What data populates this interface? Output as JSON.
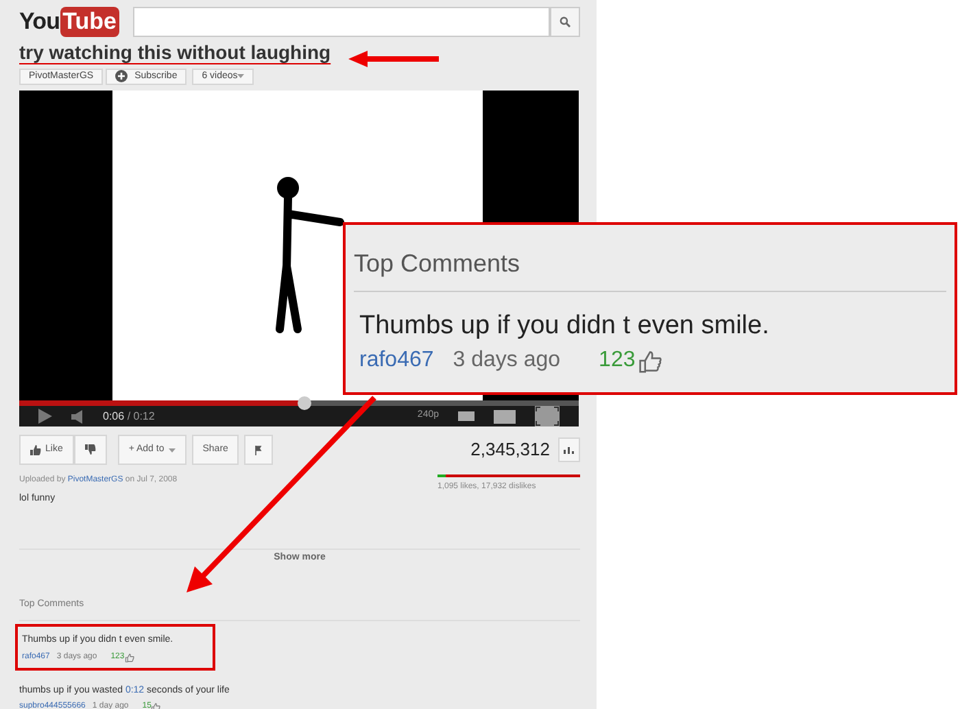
{
  "header": {
    "logo_left": "You",
    "logo_right": "Tube"
  },
  "video_title": "try watching this without laughing",
  "channel_bar": {
    "channel": "PivotMasterGS",
    "subscribe": "Subscribe",
    "videos": "6 videos"
  },
  "player": {
    "time_current": "0:06",
    "time_total": "/ 0:12",
    "quality": "240p",
    "level": 0.51
  },
  "actions": [
    {
      "kind": "like",
      "label": "Like"
    },
    {
      "kind": "dislike"
    },
    {
      "kind": "add",
      "label": "+ Add to"
    },
    {
      "kind": "share",
      "label": "Share"
    },
    {
      "kind": "flag"
    }
  ],
  "view_count": "2,345,312",
  "ratings": {
    "level": 0.06,
    "text": "1,095 likes, 17,932 dislikes"
  },
  "upload": {
    "prefix": "Uploaded by",
    "uploader": "PivotMasterGS",
    "suffix": "on Jul 7, 2008"
  },
  "description": "lol funny",
  "show_more": "Show more",
  "callout": {
    "heading": "Top Comments",
    "text": "Thumbs up if you didn t even smile.",
    "author": "rafo467",
    "age": "3 days ago",
    "likes": "123"
  },
  "top_comments": {
    "heading": "Top Comments",
    "comments": [
      {
        "highlighted": true,
        "parts": [
          {
            "kind": "plain",
            "text": "Thumbs up if you didn t even smile."
          }
        ],
        "author": "rafo467",
        "age": "3 days ago",
        "likes": "123"
      },
      {
        "highlighted": false,
        "parts": [
          {
            "kind": "plain",
            "text": "thumbs up if you wasted"
          },
          {
            "kind": "link",
            "text": "0:12"
          },
          {
            "kind": "plain",
            "text": "seconds of your life"
          }
        ],
        "author": "supbro444555666",
        "age": "1 day ago",
        "likes": "15"
      }
    ]
  }
}
